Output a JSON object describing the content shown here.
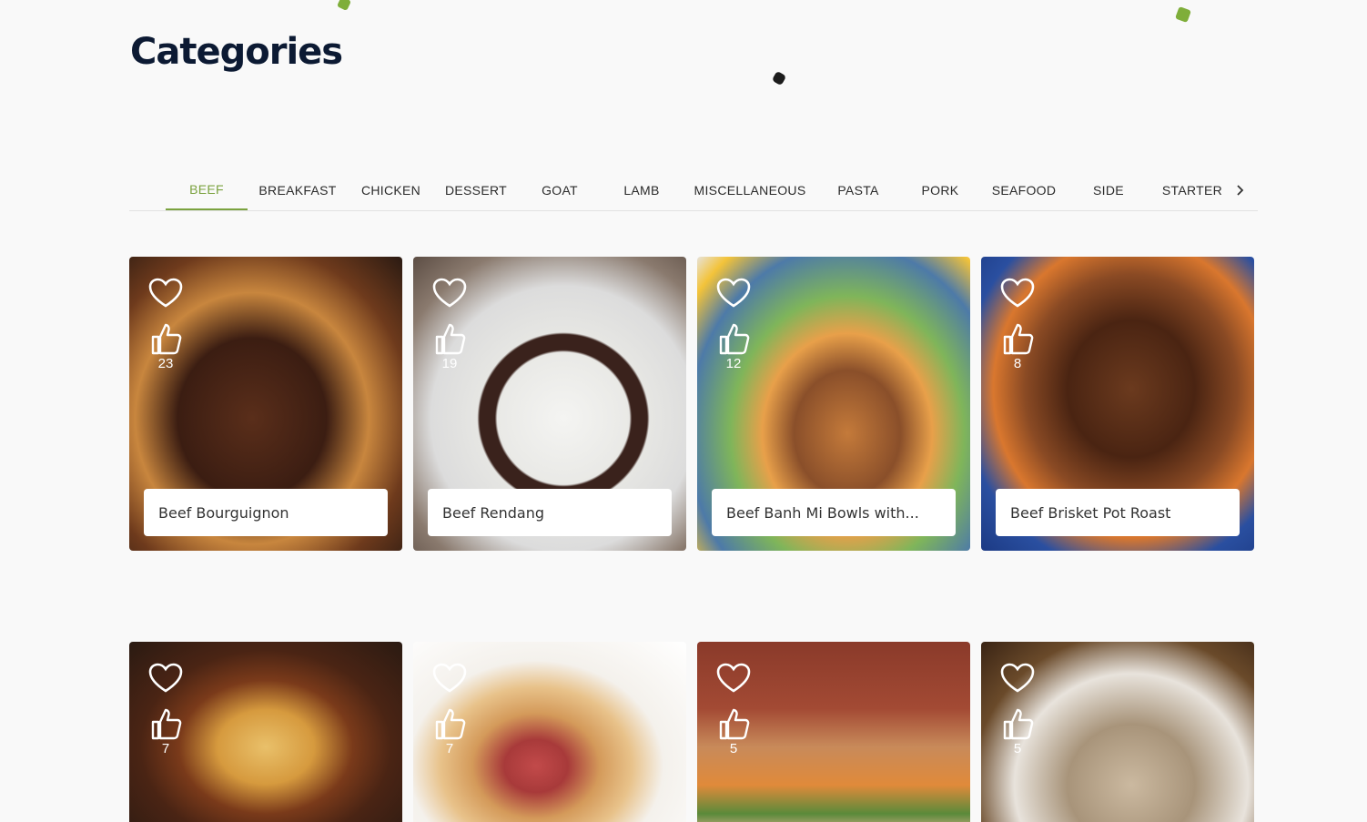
{
  "page": {
    "title": "Categories"
  },
  "tabs": [
    {
      "label": "BEEF",
      "active": true
    },
    {
      "label": "BREAKFAST"
    },
    {
      "label": "CHICKEN"
    },
    {
      "label": "DESSERT"
    },
    {
      "label": "GOAT"
    },
    {
      "label": "LAMB"
    },
    {
      "label": "MISCELLANEOUS"
    },
    {
      "label": "PASTA"
    },
    {
      "label": "PORK"
    },
    {
      "label": "SEAFOOD"
    },
    {
      "label": "SIDE"
    },
    {
      "label": "STARTER"
    }
  ],
  "colors": {
    "accent": "#7ba23f",
    "title": "#0c1a33"
  },
  "recipes": [
    {
      "name": "Beef Bourguignon",
      "likes": "23"
    },
    {
      "name": "Beef Rendang",
      "likes": "19"
    },
    {
      "name": "Beef Banh Mi Bowls with...",
      "likes": "12"
    },
    {
      "name": "Beef Brisket Pot Roast",
      "likes": "8"
    },
    {
      "name": "",
      "likes": "7"
    },
    {
      "name": "",
      "likes": "7"
    },
    {
      "name": "",
      "likes": "5"
    },
    {
      "name": "",
      "likes": "5"
    }
  ]
}
